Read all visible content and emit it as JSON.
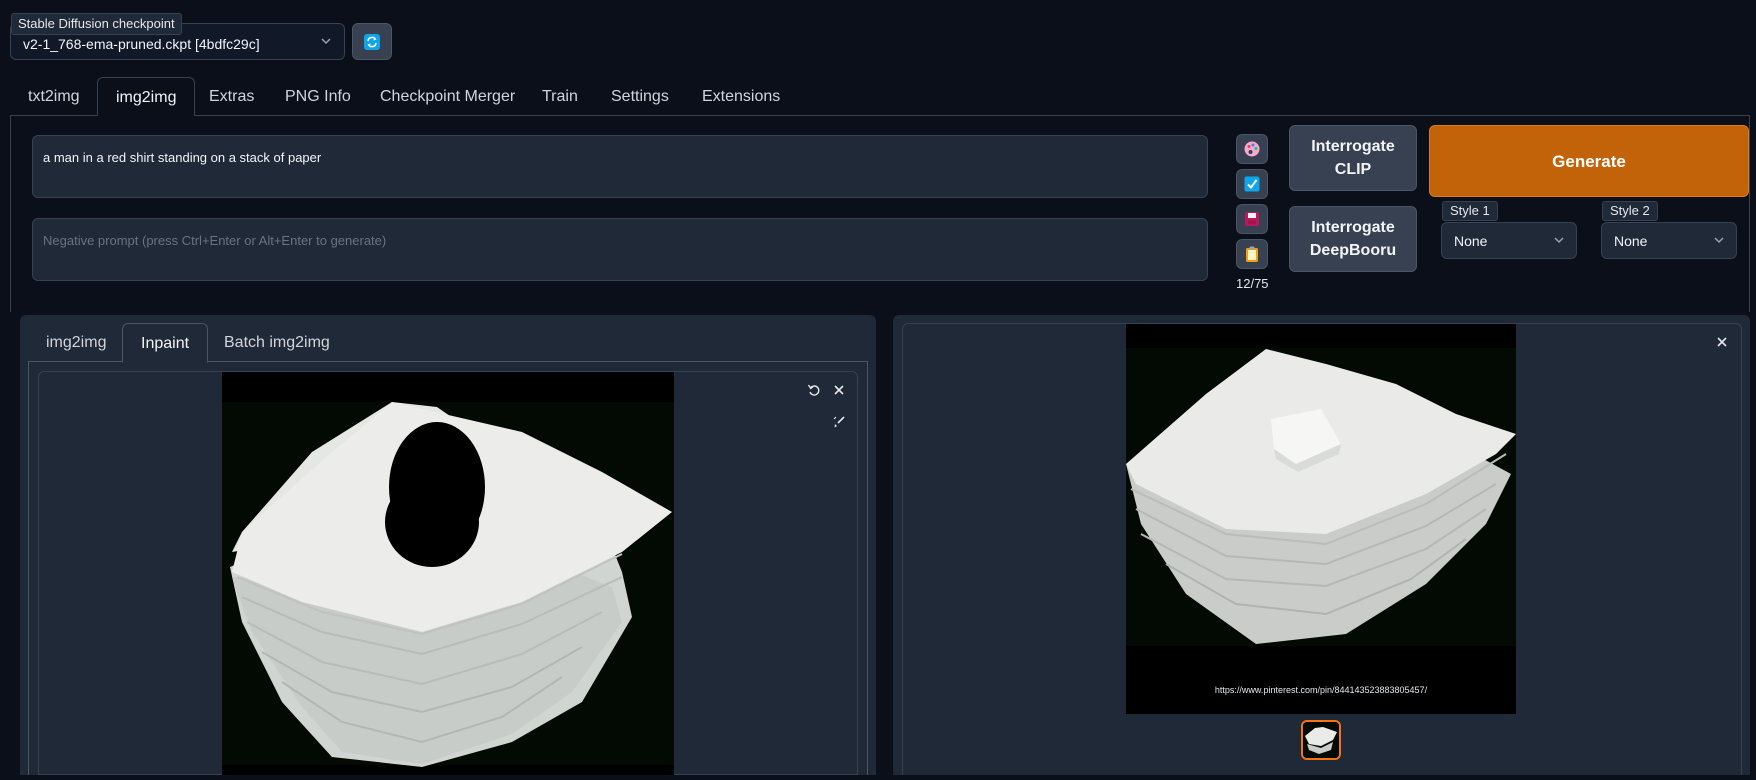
{
  "checkpoint": {
    "label": "Stable Diffusion checkpoint",
    "value": "v2-1_768-ema-pruned.ckpt [4bdfc29c]",
    "refresh_icon": "refresh-icon"
  },
  "top_tabs": [
    "txt2img",
    "img2img",
    "Extras",
    "PNG Info",
    "Checkpoint Merger",
    "Train",
    "Settings",
    "Extensions"
  ],
  "active_top_tab": "img2img",
  "prompt": {
    "value": "a man in a red shirt standing on a stack of paper",
    "negative_placeholder": "Negative prompt (press Ctrl+Enter or Alt+Enter to generate)"
  },
  "tools": [
    "palette-icon",
    "checkbox-icon",
    "save-icon",
    "clipboard-icon"
  ],
  "token_count": "12/75",
  "buttons": {
    "interrogate_clip": "Interrogate CLIP",
    "interrogate_deepbooru": "Interrogate DeepBooru",
    "generate": "Generate"
  },
  "styles": {
    "style1_label": "Style 1",
    "style1_value": "None",
    "style2_label": "Style 2",
    "style2_value": "None"
  },
  "sub_tabs": [
    "img2img",
    "Inpaint",
    "Batch img2img"
  ],
  "active_sub_tab": "Inpaint",
  "output": {
    "url_text": "https://www.pinterest.com/pin/844143523883805457/"
  },
  "colors": {
    "background": "#0b0f19",
    "panel": "#1f2937",
    "generate": "#c2630a",
    "thumb_border": "#f97316"
  }
}
